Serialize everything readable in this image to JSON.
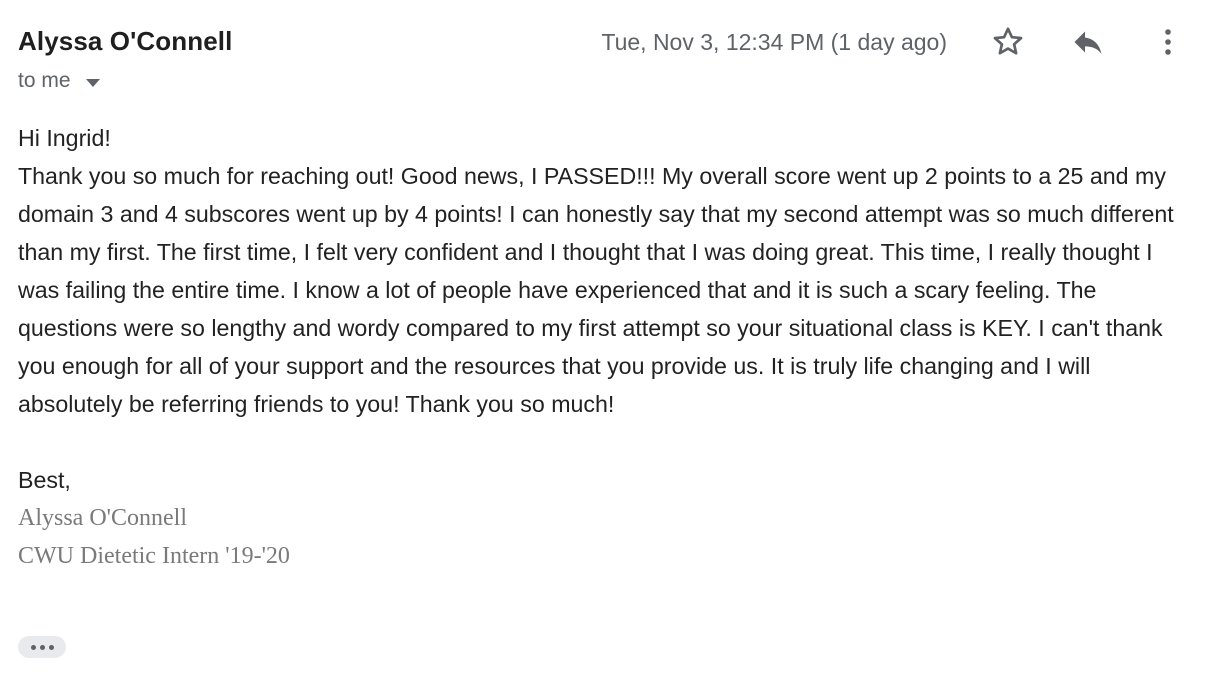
{
  "header": {
    "sender_name": "Alyssa O'Connell",
    "timestamp": "Tue, Nov 3, 12:34 PM (1 day ago)",
    "recipient_label": "to me",
    "icons": {
      "star": "star-outline-icon",
      "reply": "reply-icon",
      "more": "more-vert-icon",
      "caret": "caret-down-icon"
    }
  },
  "message": {
    "greeting": "Hi Ingrid!",
    "paragraph": "Thank you so much for reaching out! Good news, I PASSED!!! My overall score went up 2 points to a 25 and my domain 3 and 4 subscores went up by 4 points! I can honestly say that my second attempt was so much different than my first. The first time, I felt very confident and I thought that I was doing great. This time, I really thought I was failing the entire time. I know a lot of people have experienced that and it is such a scary feeling. The questions were so lengthy and wordy compared to my first attempt so your situational class is KEY. I can't thank you enough for all of your support and the resources that you provide us. It is truly life changing and I will absolutely be referring friends to you! Thank you so much!",
    "closing": "Best,",
    "signature_name": "Alyssa O'Connell",
    "signature_title": "CWU Dietetic Intern '19-'20"
  },
  "colors": {
    "text": "#222222",
    "muted": "#5f6368",
    "signature": "#7a7a7a",
    "pill_background": "#e8eaed"
  }
}
